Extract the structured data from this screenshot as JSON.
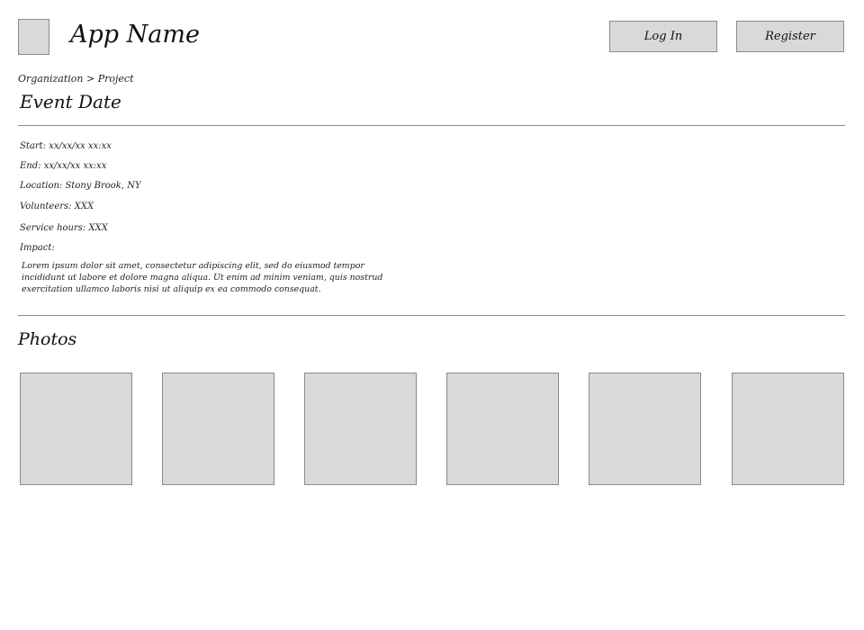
{
  "header": {
    "app_name": "App Name",
    "login_label": "Log In",
    "register_label": "Register"
  },
  "breadcrumb": {
    "organization": "Organization",
    "separator": ">",
    "project": "Project"
  },
  "event": {
    "title": "Event Date",
    "start": "Start: xx/xx/xx xx:xx",
    "end": "End: xx/xx/xx xx:xx",
    "location": "Location: Stony Brook, NY",
    "volunteers": "Volunteers: XXX",
    "service_hours": "Service hours: XXX",
    "impact_label": "Impact:",
    "impact_text": "Lorem ipsum dolor sit amet, consectetur adipiscing elit, sed do eiusmod tempor incididunt ut labore et dolore magna aliqua. Ut enim ad minim veniam, quis nostrud exercitation ullamco laboris nisi ut aliquip ex ea commodo consequat."
  },
  "photos": {
    "title": "Photos"
  },
  "colors": {
    "placeholder_fill": "#d9d9d9",
    "border": "#8a8a8a",
    "divider": "#8a8a8a",
    "text": "#1a1a1a"
  }
}
